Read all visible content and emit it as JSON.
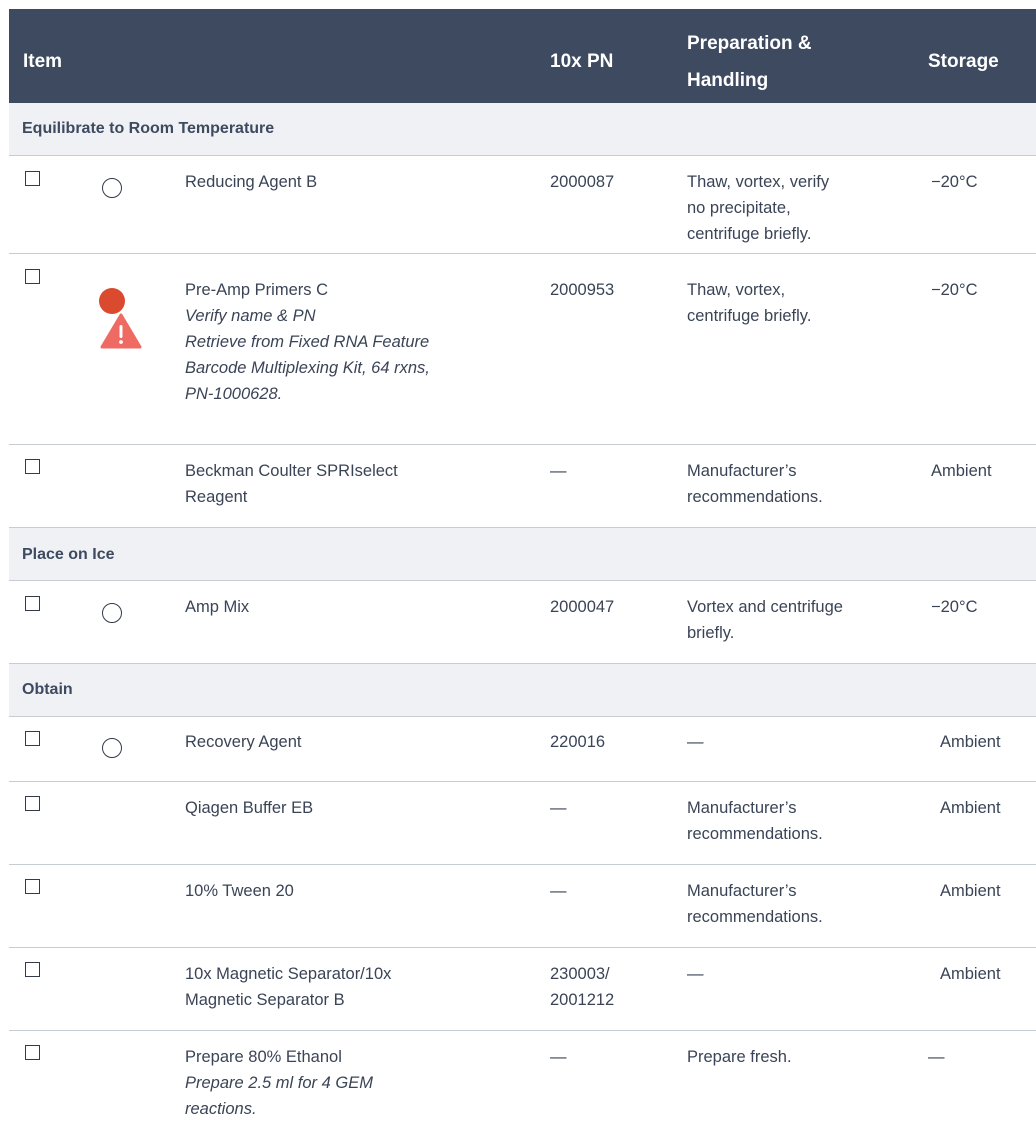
{
  "header": {
    "item": "Item",
    "pn": "10x PN",
    "prep_line1": "Preparation &",
    "prep_line2": "Handling",
    "storage": "Storage"
  },
  "sections": [
    {
      "title": "Equilibrate to Room Temperature",
      "rows": [
        {
          "marker": "circle",
          "name": "Reducing Agent B",
          "notes": [],
          "pn_lines": [
            "2000087"
          ],
          "prep_lines": [
            "Thaw, vortex, verify",
            "no precipitate,",
            "centrifuge briefly."
          ],
          "storage": "−20°C"
        },
        {
          "marker": "dot-warning",
          "name": "Pre-Amp Primers C",
          "notes": [
            "Verify name & PN",
            "Retrieve from Fixed RNA Feature",
            "Barcode Multiplexing Kit, 64 rxns,",
            "PN-1000628."
          ],
          "pn_lines": [
            "2000953"
          ],
          "prep_lines": [
            "Thaw, vortex,",
            "centrifuge briefly."
          ],
          "storage": "−20°C"
        },
        {
          "marker": "",
          "name": "Beckman Coulter SPRIselect",
          "name2": "Reagent",
          "notes": [],
          "pn_lines": [
            "—"
          ],
          "prep_lines": [
            "Manufacturer’s",
            "recommendations."
          ],
          "storage": "Ambient"
        }
      ]
    },
    {
      "title": "Place on Ice",
      "rows": [
        {
          "marker": "circle",
          "name": "Amp Mix",
          "notes": [],
          "pn_lines": [
            "2000047"
          ],
          "prep_lines": [
            "Vortex and centrifuge",
            "briefly."
          ],
          "storage": "−20°C"
        }
      ]
    },
    {
      "title": "Obtain",
      "rows": [
        {
          "marker": "circle",
          "name": "Recovery Agent",
          "notes": [],
          "pn_lines": [
            "220016"
          ],
          "prep_lines": [
            "—"
          ],
          "storage": "Ambient"
        },
        {
          "marker": "",
          "name": "Qiagen Buffer EB",
          "notes": [],
          "pn_lines": [
            "—"
          ],
          "prep_lines": [
            "Manufacturer’s",
            "recommendations."
          ],
          "storage": "Ambient"
        },
        {
          "marker": "",
          "name": "10% Tween 20",
          "notes": [],
          "pn_lines": [
            "—"
          ],
          "prep_lines": [
            "Manufacturer’s",
            "recommendations."
          ],
          "storage": "Ambient"
        },
        {
          "marker": "",
          "name": "10x Magnetic Separator/10x",
          "name2": "Magnetic Separator B",
          "notes": [],
          "pn_lines": [
            "230003/",
            "2001212"
          ],
          "prep_lines": [
            "—"
          ],
          "storage": "Ambient"
        },
        {
          "marker": "",
          "name": "Prepare 80% Ethanol",
          "notes": [
            "Prepare 2.5 ml for 4 GEM",
            "reactions."
          ],
          "pn_lines": [
            "—"
          ],
          "prep_lines": [
            "Prepare fresh."
          ],
          "storage": "—"
        }
      ]
    }
  ],
  "colors": {
    "header_bg": "#3e4a5f",
    "section_bg": "#eff1f4",
    "rule": "#c7ccd3",
    "dot": "#d94a2e",
    "warning": "#ef6a62"
  },
  "icons": {
    "checkbox": "checkbox-icon",
    "circle": "empty-circle-icon",
    "dot": "red-dot-icon",
    "warning": "warning-triangle-icon"
  }
}
